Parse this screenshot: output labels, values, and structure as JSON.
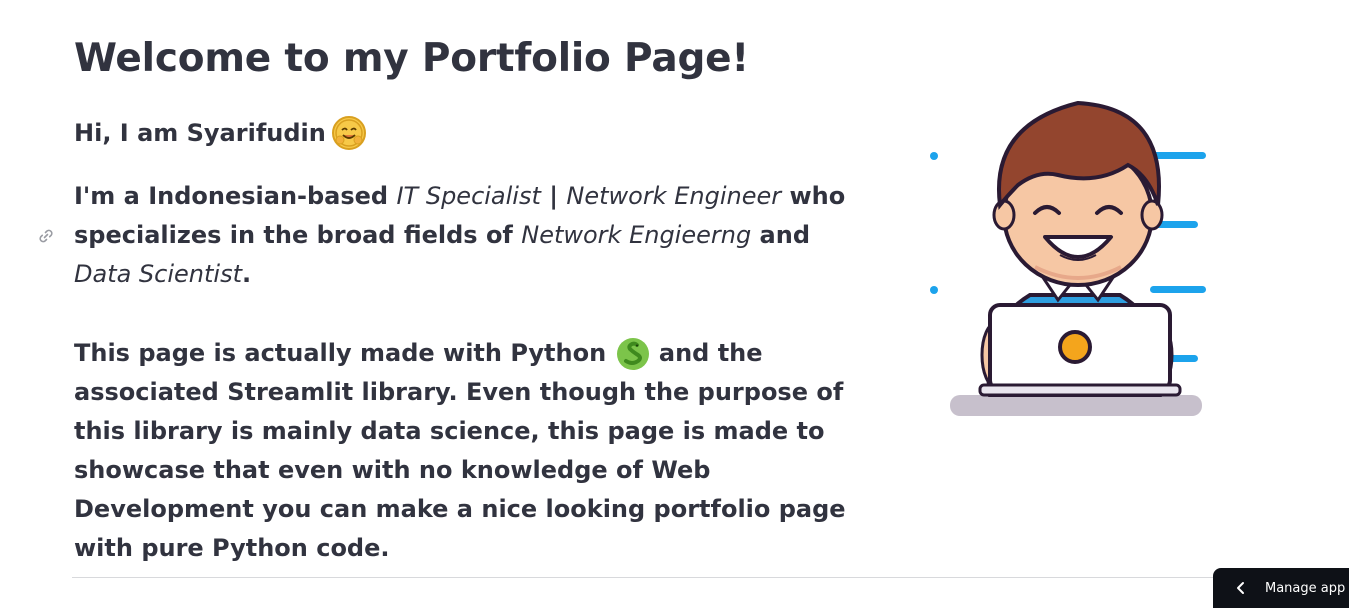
{
  "page": {
    "title": "Welcome to my Portfolio Page!",
    "greeting": "Hi, I am Syarifudin",
    "greeting_emoji_icon": "hugging-face-icon",
    "intro": {
      "p1_text_a": "I'm a Indonesian-based ",
      "p1_em_a": "IT Specialist",
      "p1_text_b": " | ",
      "p1_em_b": "Network Engineer",
      "p1_text_c": " who specializes in the broad fields of ",
      "p1_em_c": "Network Engieerng",
      "p1_text_d": " and ",
      "p1_em_d": "Data Scientist",
      "p1_text_e": "."
    },
    "about": {
      "p2_text_a": "This page is actually made with Python ",
      "p2_emoji_icon": "snake-icon",
      "p2_text_b": " and the associated Streamlit library. Even though the purpose of this library is mainly data science, this page is made to showcase that even with no knowledge of Web Development you can make a nice looking portfolio page with pure Python code."
    },
    "illustration_icon": "developer-laptop-illustration"
  },
  "footer": {
    "manage_app_label": "Manage app",
    "manage_app_icon": "chevron-left-icon"
  },
  "colors": {
    "text": "#31333f",
    "accent_blue": "#1ca3ec",
    "button_bg": "#0e1117"
  }
}
